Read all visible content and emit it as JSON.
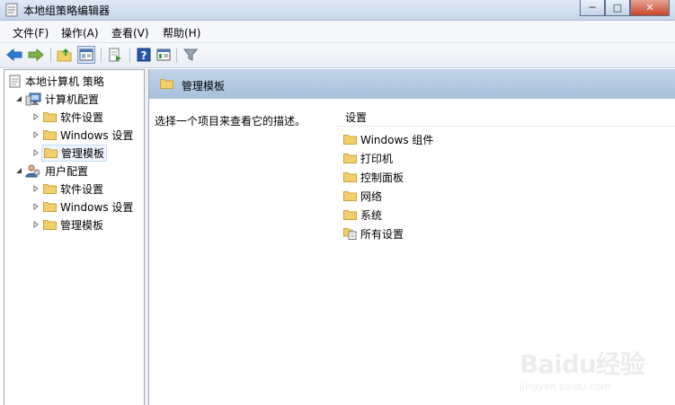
{
  "window": {
    "title": "本地组策略编辑器",
    "controls": {
      "minimize": "─",
      "maximize": "□",
      "close": "✕"
    }
  },
  "menu": [
    "文件(F)",
    "操作(A)",
    "查看(V)",
    "帮助(H)"
  ],
  "toolbar": {
    "icons": [
      "back-arrow-icon",
      "forward-arrow-icon",
      "up-folder-icon",
      "show-hide-tree-icon",
      "export-list-icon",
      "help-icon",
      "properties-icon",
      "filter-icon"
    ]
  },
  "tree": {
    "root": "本地计算机 策略",
    "computer_config": {
      "label": "计算机配置",
      "children": [
        "软件设置",
        "Windows 设置",
        "管理模板"
      ],
      "selected": "管理模板"
    },
    "user_config": {
      "label": "用户配置",
      "children": [
        "软件设置",
        "Windows 设置",
        "管理模板"
      ]
    }
  },
  "details": {
    "header": "管理模板",
    "description": "选择一个项目来查看它的描述。",
    "column_header": "设置",
    "items": [
      {
        "label": "Windows 组件",
        "icon": "folder"
      },
      {
        "label": "打印机",
        "icon": "folder"
      },
      {
        "label": "控制面板",
        "icon": "folder"
      },
      {
        "label": "网络",
        "icon": "folder"
      },
      {
        "label": "系统",
        "icon": "folder"
      },
      {
        "label": "所有设置",
        "icon": "settings-doc"
      }
    ]
  },
  "watermark": {
    "logo": "Baidu经验",
    "url": "jingyan.baidu.com"
  },
  "colors": {
    "titlebar": "#c5d6ea",
    "header": "#a8c0dc",
    "close": "#c7462d",
    "folder": "#f2cf6a"
  }
}
